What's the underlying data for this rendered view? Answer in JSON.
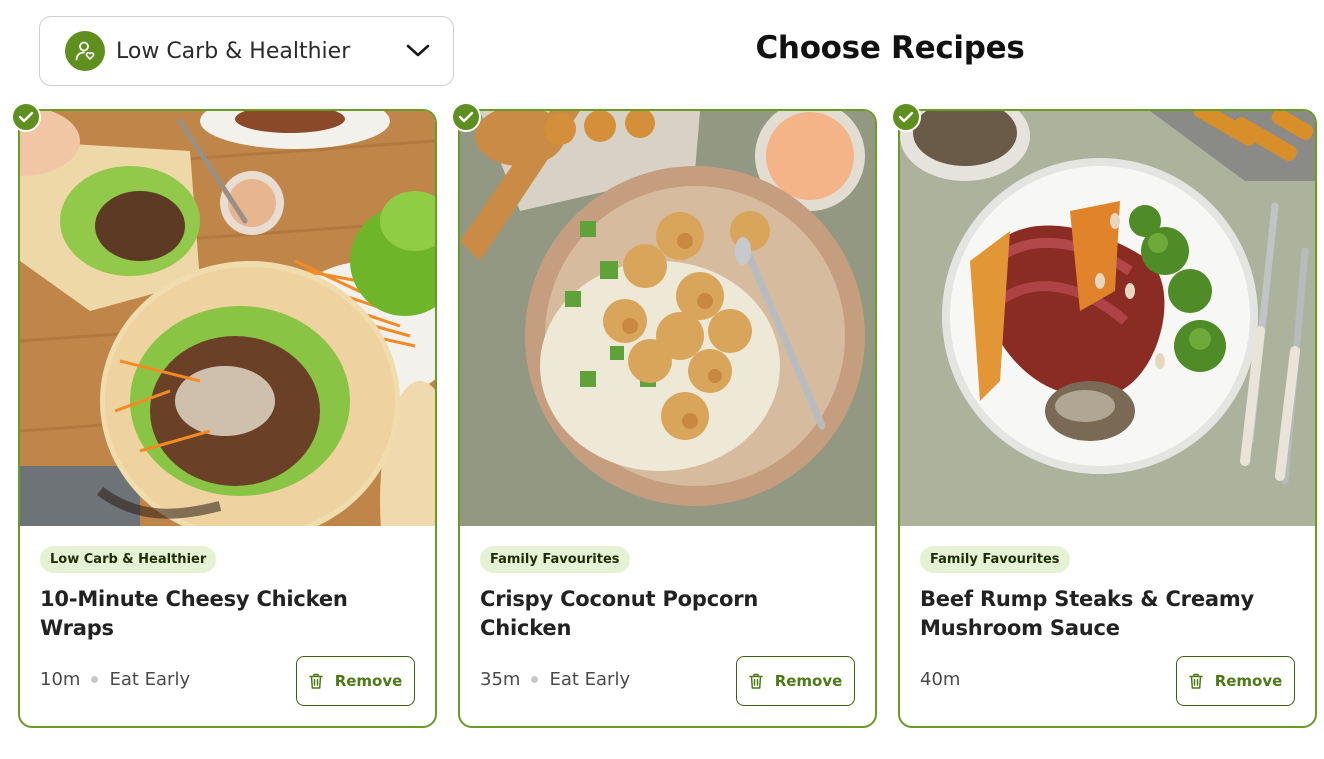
{
  "plan_selector": {
    "label": "Low Carb & Healthier",
    "icon": "person-heart-icon",
    "toggle_icon": "chevron-down-icon"
  },
  "page_title": "Choose Recipes",
  "colors": {
    "accent_green": "#5f8f1f",
    "card_border": "#6b9a26",
    "tag_bg": "#e5f2d3",
    "remove_text": "#4c7a17"
  },
  "recipes": [
    {
      "selected": true,
      "tag": "Low Carb & Healthier",
      "title": "10-Minute Cheesy Chicken Wraps",
      "time": "10m",
      "note": "Eat Early",
      "remove_label": "Remove",
      "remove_icon": "trash-icon"
    },
    {
      "selected": true,
      "tag": "Family Favourites",
      "title": "Crispy Coconut Popcorn Chicken",
      "time": "35m",
      "note": "Eat Early",
      "remove_label": "Remove",
      "remove_icon": "trash-icon"
    },
    {
      "selected": true,
      "tag": "Family Favourites",
      "title": "Beef Rump Steaks & Creamy Mushroom Sauce",
      "time": "40m",
      "note": "",
      "remove_label": "Remove",
      "remove_icon": "trash-icon"
    }
  ]
}
